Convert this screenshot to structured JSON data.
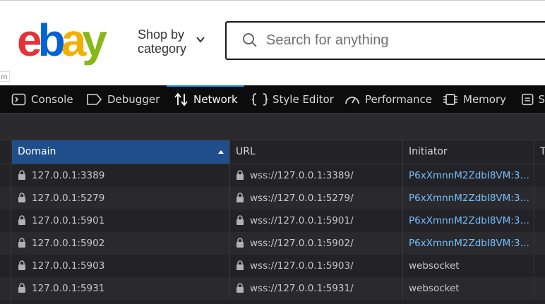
{
  "ebay": {
    "logo": {
      "e": "e",
      "b": "b",
      "a": "a",
      "y": "y"
    },
    "shop_line1": "Shop by",
    "shop_line2": "category",
    "search_placeholder": "Search for anything",
    "fragment": "m"
  },
  "devtools": {
    "tabs": [
      {
        "label": "Console",
        "icon": "console-icon"
      },
      {
        "label": "Debugger",
        "icon": "debugger-icon"
      },
      {
        "label": "Network",
        "icon": "network-icon",
        "active": true
      },
      {
        "label": "Style Editor",
        "icon": "style-editor-icon"
      },
      {
        "label": "Performance",
        "icon": "performance-icon"
      },
      {
        "label": "Memory",
        "icon": "memory-icon"
      },
      {
        "label": "S",
        "icon": "storage-icon"
      }
    ],
    "columns": [
      "Domain",
      "URL",
      "Initiator",
      "Ty"
    ],
    "rows": [
      {
        "domain": "127.0.0.1:3389",
        "url": "wss://127.0.0.1:3389/",
        "initiator": "P6xXmnnM2ZdbI8VM:3…",
        "initiator_link": true
      },
      {
        "domain": "127.0.0.1:5279",
        "url": "wss://127.0.0.1:5279/",
        "initiator": "P6xXmnnM2ZdbI8VM:3…",
        "initiator_link": true
      },
      {
        "domain": "127.0.0.1:5901",
        "url": "wss://127.0.0.1:5901/",
        "initiator": "P6xXmnnM2ZdbI8VM:3…",
        "initiator_link": true
      },
      {
        "domain": "127.0.0.1:5902",
        "url": "wss://127.0.0.1:5902/",
        "initiator": "P6xXmnnM2ZdbI8VM:3…",
        "initiator_link": true
      },
      {
        "domain": "127.0.0.1:5903",
        "url": "wss://127.0.0.1:5903/",
        "initiator": "websocket",
        "initiator_link": false
      },
      {
        "domain": "127.0.0.1:5931",
        "url": "wss://127.0.0.1:5931/",
        "initiator": "websocket",
        "initiator_link": false
      }
    ]
  },
  "colors": {
    "accent": "#0a84ff",
    "sorted_header": "#204e8a",
    "link": "#75bfff"
  }
}
